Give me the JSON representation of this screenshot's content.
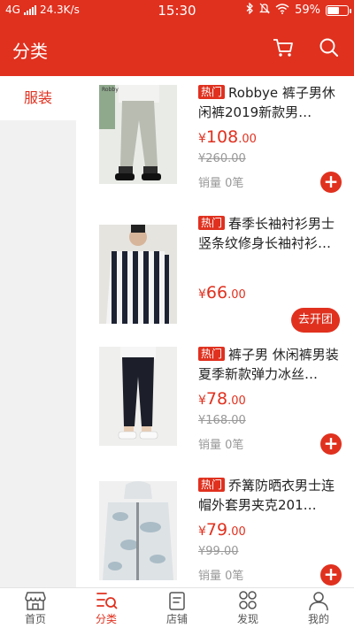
{
  "status_bar": {
    "network": "4G",
    "speed": "24.3K/s",
    "time": "15:30",
    "battery": "59%",
    "battery_level": 0.59
  },
  "header": {
    "title": "分类",
    "cart_icon": "cart-icon",
    "search_icon": "search-icon"
  },
  "categories": [
    {
      "label": "服装",
      "active": true
    }
  ],
  "products": [
    {
      "badge": "热门",
      "title": "Robbye 裤子男休闲裤2019新款男…",
      "price_currency": "¥",
      "price_int": "108",
      "price_dec": ".00",
      "original_price": "¥260.00",
      "sales": "销量 0笔",
      "action": "add"
    },
    {
      "badge": "热门",
      "title": "春季长袖衬衫男士竖条纹修身长袖衬衫…",
      "price_currency": "¥",
      "price_int": "66",
      "price_dec": ".00",
      "action": "group",
      "action_label": "去开团"
    },
    {
      "badge": "热门",
      "title": "裤子男 休闲裤男装夏季新款弹力冰丝…",
      "price_currency": "¥",
      "price_int": "78",
      "price_dec": ".00",
      "original_price": "¥168.00",
      "sales": "销量 0笔",
      "action": "add"
    },
    {
      "badge": "热门",
      "title": "乔篝防晒衣男士连帽外套男夹克201…",
      "price_currency": "¥",
      "price_int": "79",
      "price_dec": ".00",
      "original_price": "¥99.00",
      "sales": "销量 0笔",
      "action": "add"
    }
  ],
  "bottom_nav": [
    {
      "label": "首页",
      "icon": "shop-front-icon",
      "active": false
    },
    {
      "label": "分类",
      "icon": "category-list-icon",
      "active": true
    },
    {
      "label": "店铺",
      "icon": "store-receipt-icon",
      "active": false
    },
    {
      "label": "发现",
      "icon": "discover-grid-icon",
      "active": false
    },
    {
      "label": "我的",
      "icon": "person-icon",
      "active": false
    }
  ],
  "colors": {
    "brand": "#e0311f",
    "muted": "#999999",
    "sidebar_bg": "#f1f1f1"
  }
}
